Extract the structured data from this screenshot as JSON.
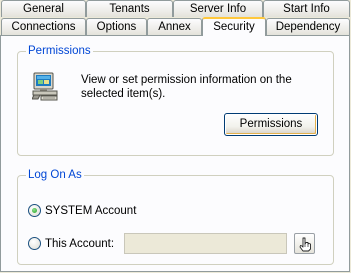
{
  "tabs": {
    "back_row": [
      {
        "label": "General"
      },
      {
        "label": "Tenants"
      },
      {
        "label": "Server Info"
      },
      {
        "label": "Start Info"
      }
    ],
    "front_row": [
      {
        "label": "Connections"
      },
      {
        "label": "Options"
      },
      {
        "label": "Annex"
      },
      {
        "label": "Security"
      },
      {
        "label": "Dependency"
      }
    ],
    "selected": "Security"
  },
  "permissions": {
    "title": "Permissions",
    "icon": "computer-icon",
    "description": "View or set permission information on the selected item(s).",
    "button_label": "Permissions"
  },
  "logon": {
    "title": "Log On As",
    "system_account_label": "SYSTEM Account",
    "system_account_selected": true,
    "this_account_label": "This Account:",
    "this_account_value": "",
    "browse_icon": "hand-pointer-icon"
  },
  "colors": {
    "group_title": "#0046d5",
    "selected_tab_accent": "#ffc83c",
    "window_bg": "#ece9d8"
  }
}
